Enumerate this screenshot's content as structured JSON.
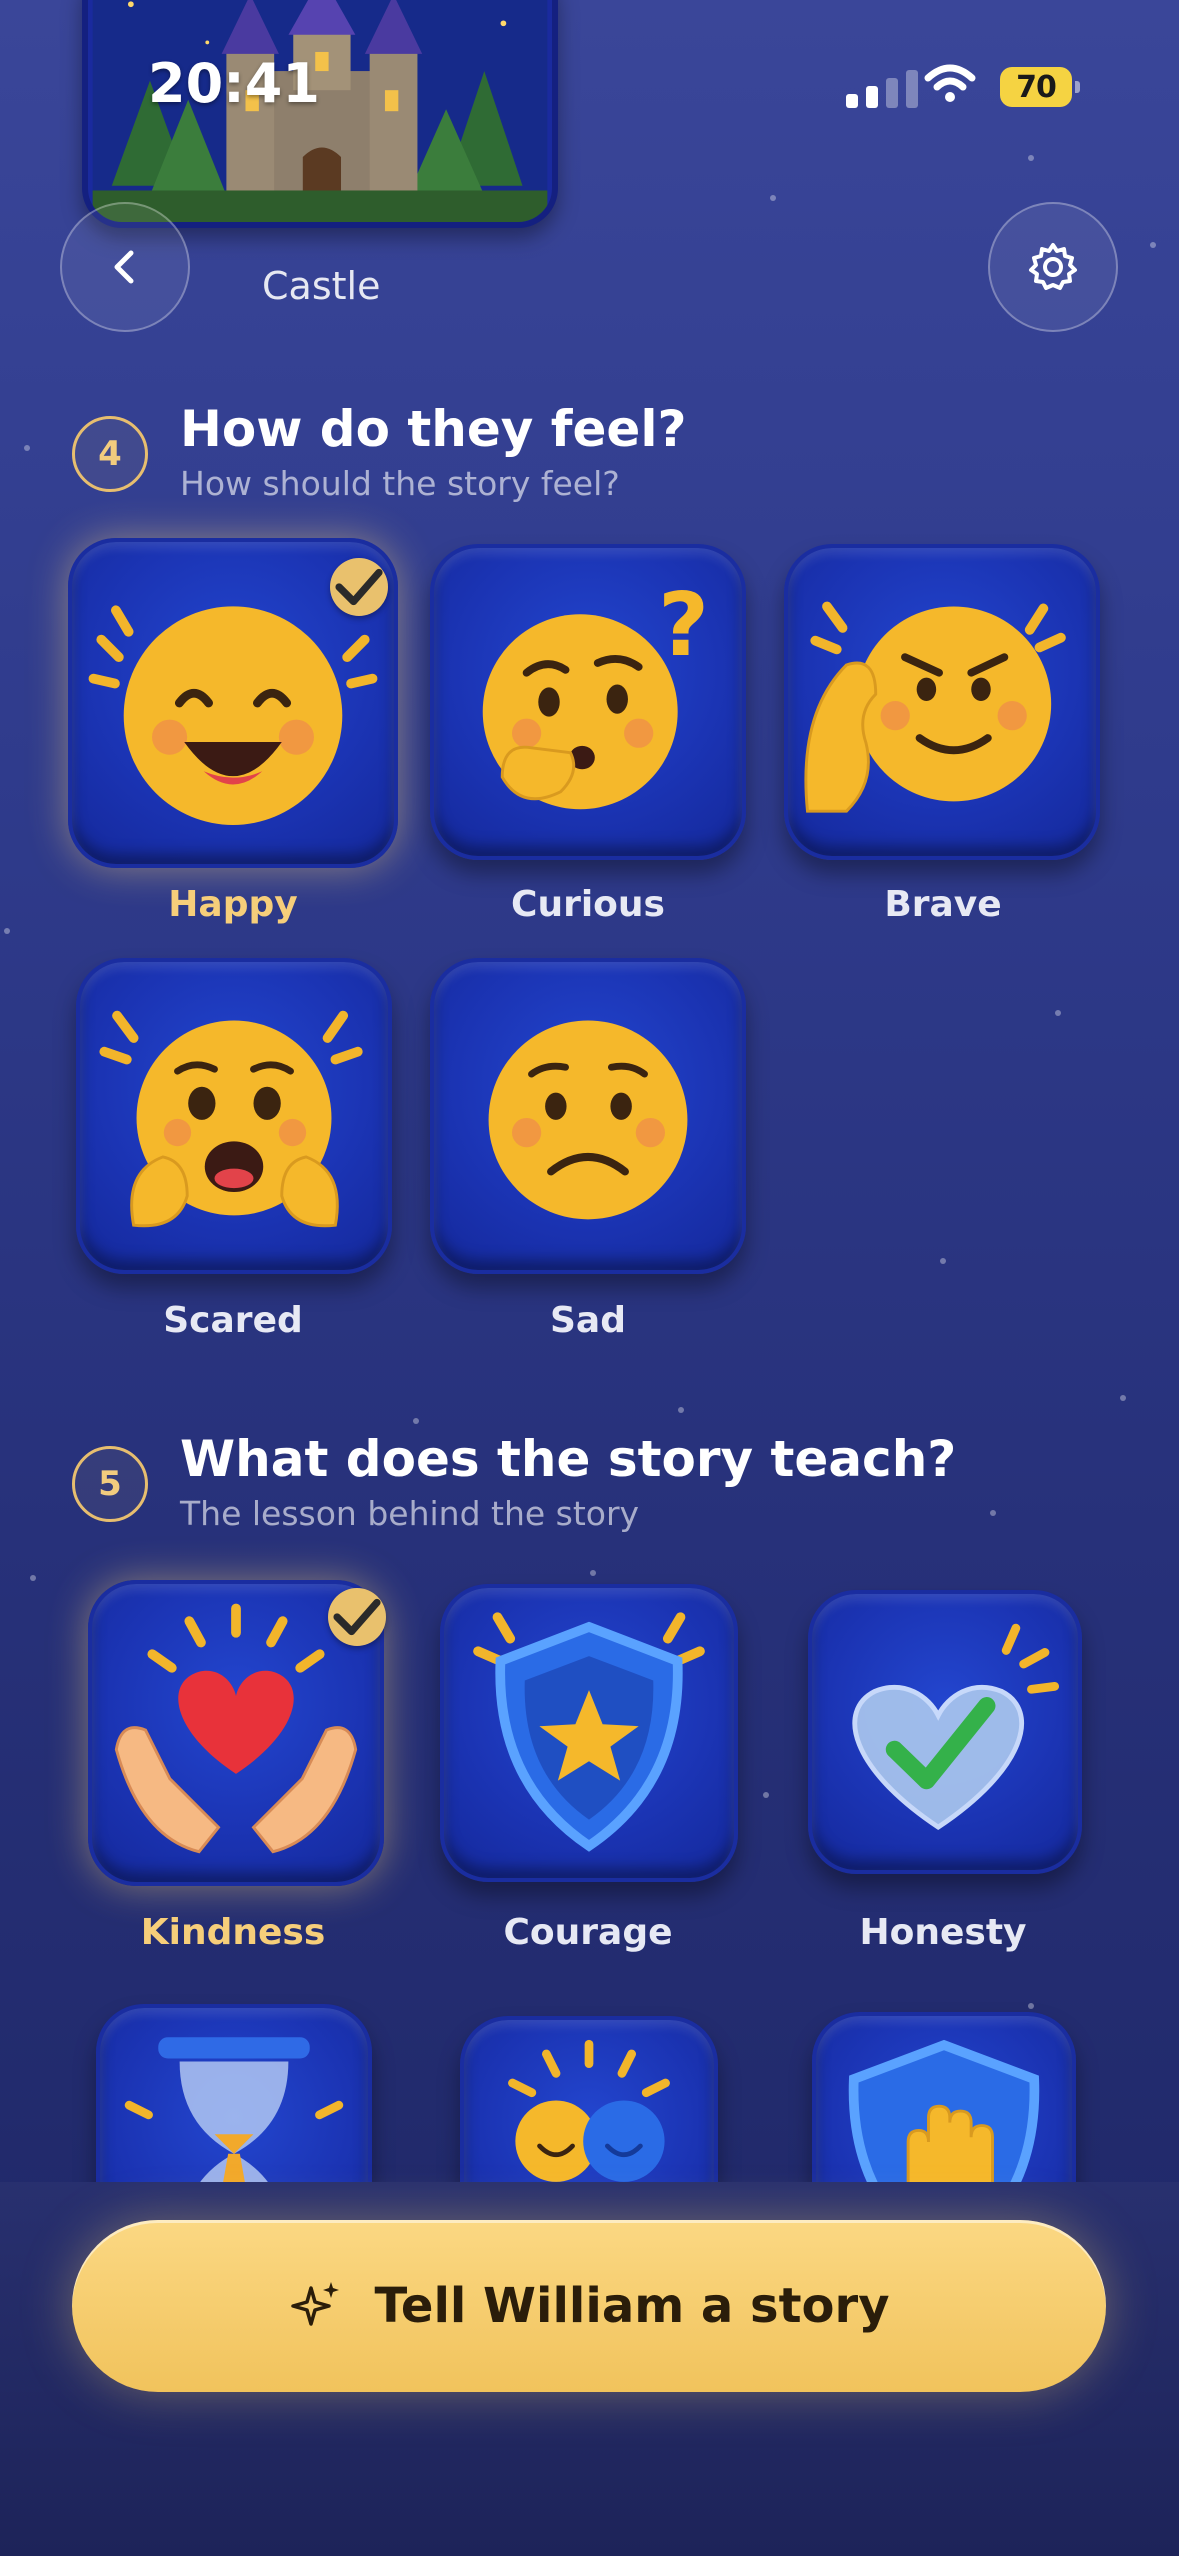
{
  "status_bar": {
    "time": "20:41",
    "battery": "70"
  },
  "header": {
    "destination_label": "Castle"
  },
  "colors": {
    "accent": "#f2c464",
    "background": "#2f3b8c",
    "tile": "#1b34b4"
  },
  "section_feel": {
    "step": "4",
    "title": "How do they feel?",
    "subtitle": "How should the story feel?",
    "options": [
      {
        "label": "Happy",
        "icon": "happy-face-icon",
        "selected": true
      },
      {
        "label": "Curious",
        "icon": "curious-face-icon",
        "selected": false
      },
      {
        "label": "Brave",
        "icon": "brave-face-icon",
        "selected": false
      },
      {
        "label": "Scared",
        "icon": "scared-face-icon",
        "selected": false
      },
      {
        "label": "Sad",
        "icon": "sad-face-icon",
        "selected": false
      }
    ]
  },
  "section_lesson": {
    "step": "5",
    "title": "What does the story teach?",
    "subtitle": "The lesson behind the story",
    "options": [
      {
        "label": "Kindness",
        "icon": "heart-hands-icon",
        "selected": true
      },
      {
        "label": "Courage",
        "icon": "star-shield-icon",
        "selected": false
      },
      {
        "label": "Honesty",
        "icon": "check-heart-icon",
        "selected": false
      },
      {
        "icon": "hourglass-icon",
        "selected": false
      },
      {
        "icon": "friends-icon",
        "selected": false
      },
      {
        "icon": "hand-shield-icon",
        "selected": false
      }
    ]
  },
  "cta": {
    "label": "Tell William a story",
    "icon": "sparkles-icon"
  }
}
